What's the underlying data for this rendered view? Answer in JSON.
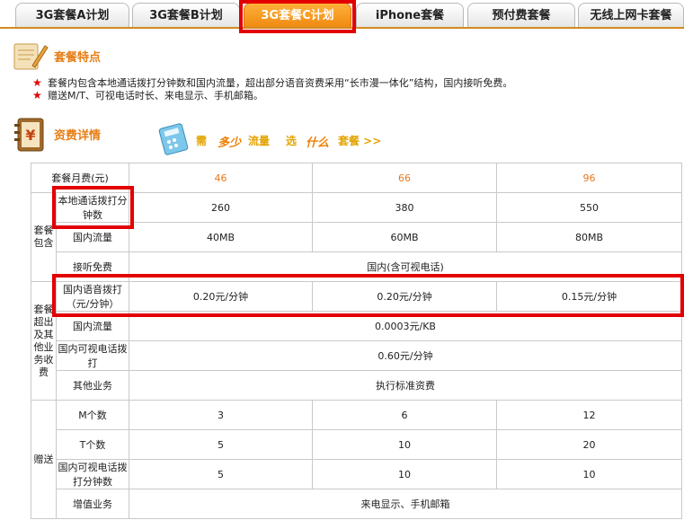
{
  "tabs": [
    {
      "label": "3G套餐A计划",
      "active": false
    },
    {
      "label": "3G套餐B计划",
      "active": false
    },
    {
      "label": "3G套餐C计划",
      "active": true
    },
    {
      "label": "iPhone套餐",
      "active": false
    },
    {
      "label": "预付费套餐",
      "active": false
    },
    {
      "label": "无线上网卡套餐",
      "active": false
    }
  ],
  "features": {
    "title": "套餐特点",
    "bullets": [
      "套餐内包含本地通话拨打分钟数和国内流量，超出部分语音资费采用“长市漫一体化”结构，国内接听免费。",
      "赠送M/T、可视电话时长、来电显示、手机邮箱。"
    ]
  },
  "details": {
    "title": "资费详情",
    "promo": [
      "需",
      "多少",
      "流量",
      "选",
      "什么",
      "套餐 >>"
    ]
  },
  "table": {
    "monthly_label": "套餐月费(元)",
    "monthly": [
      "46",
      "66",
      "96"
    ],
    "included_group": "套餐包含",
    "local_minutes_label": "本地通话拨打分钟数",
    "local_minutes": [
      "260",
      "380",
      "550"
    ],
    "domestic_data_label": "国内流量",
    "domestic_data": [
      "40MB",
      "60MB",
      "80MB"
    ],
    "incoming_label": "接听免费",
    "incoming_value": "国内(含可视电话)",
    "overage_group": "套餐超出及其他业务收费",
    "voice_rate_label": "国内语音拨打（元/分钟）",
    "voice_rate": [
      "0.20元/分钟",
      "0.20元/分钟",
      "0.15元/分钟"
    ],
    "overage_data_label": "国内流量",
    "overage_data_value": "0.0003元/KB",
    "video_call_label": "国内可视电话拨打",
    "video_call_value": "0.60元/分钟",
    "other_label": "其他业务",
    "other_value": "执行标准资费",
    "gift_group": "赠送",
    "m_label": "M个数",
    "m_values": [
      "3",
      "6",
      "12"
    ],
    "t_label": "T个数",
    "t_values": [
      "5",
      "10",
      "20"
    ],
    "video_minutes_label": "国内可视电话拨打分钟数",
    "video_minutes": [
      "5",
      "10",
      "10"
    ],
    "vas_label": "增值业务",
    "vas_value": "来电显示、手机邮箱"
  },
  "colors": {
    "accent": "#e77e14",
    "highlight": "#e30000",
    "tab_active": "#f08a12"
  }
}
